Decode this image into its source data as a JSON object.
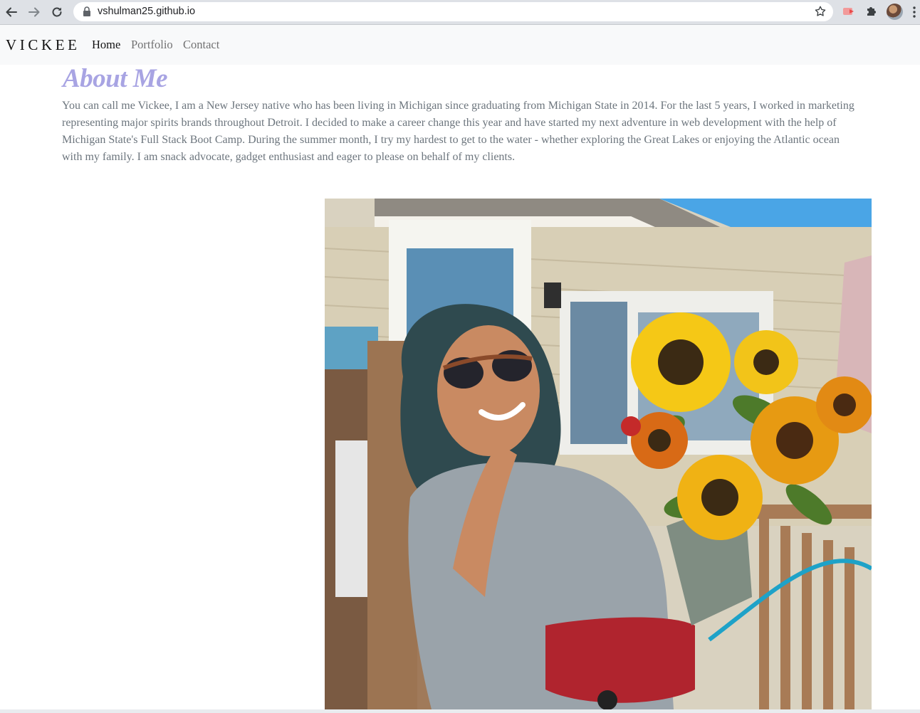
{
  "browser": {
    "url": "vshulman25.github.io",
    "back_icon": "arrow-left-icon",
    "forward_icon": "arrow-right-icon",
    "reload_icon": "reload-icon",
    "lock_icon": "lock-icon",
    "bookmark_icon": "star-icon",
    "extension_icons": [
      "cast-extension-icon",
      "puzzle-extension-icon"
    ],
    "menu_icon": "kebab-menu-icon"
  },
  "navbar": {
    "brand": "VICKEE",
    "links": [
      {
        "label": "Home",
        "active": true
      },
      {
        "label": "Portfolio",
        "active": false
      },
      {
        "label": "Contact",
        "active": false
      }
    ]
  },
  "about": {
    "title": "About Me",
    "body": "You can call me Vickee, I am a New Jersey native who has been living in Michigan since graduating from Michigan State in 2014. For the last 5 years, I worked in marketing representing major spirits brands throughout Detroit. I decided to make a career change this year and have started my next adventure in web development with the help of Michigan State's Full Stack Boot Camp. During the summer month, I try my hardest to get to the water - whether exploring the Great Lakes or enjoying the Atlantic ocean with my family. I am snack advocate, gadget enthusiast and eager to please on behalf of my clients.",
    "title_color": "#a8a4e3",
    "body_color": "#6c757d"
  }
}
